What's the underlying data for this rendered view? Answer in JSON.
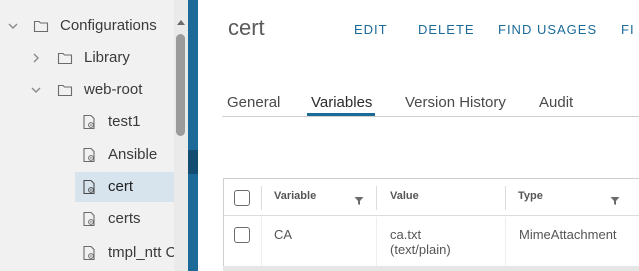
{
  "tree": {
    "items": [
      {
        "label": "Configurations",
        "kind": "folder",
        "expander": "chevron-down"
      },
      {
        "label": "Library",
        "kind": "folder",
        "expander": "chevron-right"
      },
      {
        "label": "web-root",
        "kind": "folder",
        "expander": "chevron-down"
      },
      {
        "label": "test1",
        "kind": "config-file"
      },
      {
        "label": "Ansible",
        "kind": "config-file"
      },
      {
        "label": "cert",
        "kind": "config-file",
        "selected": true
      },
      {
        "label": "certs",
        "kind": "config-file"
      },
      {
        "label": "tmpl_ntt C",
        "kind": "config-file"
      }
    ]
  },
  "header": {
    "title": "cert",
    "actions": [
      "EDIT",
      "DELETE",
      "FIND USAGES",
      "FI"
    ]
  },
  "tabs": {
    "items": [
      "General",
      "Variables",
      "Version History",
      "Audit"
    ],
    "active": "Variables"
  },
  "grid": {
    "columns": [
      "Variable",
      "Value",
      "Type"
    ],
    "rows": [
      {
        "variable": "CA",
        "value_line1": "ca.txt",
        "value_line2": "(text/plain)",
        "type": "MimeAttachment"
      }
    ]
  },
  "colors": {
    "accent": "#1b6a98",
    "tree_background": "#f1f1f1",
    "selected_row": "#d7e4ee"
  }
}
